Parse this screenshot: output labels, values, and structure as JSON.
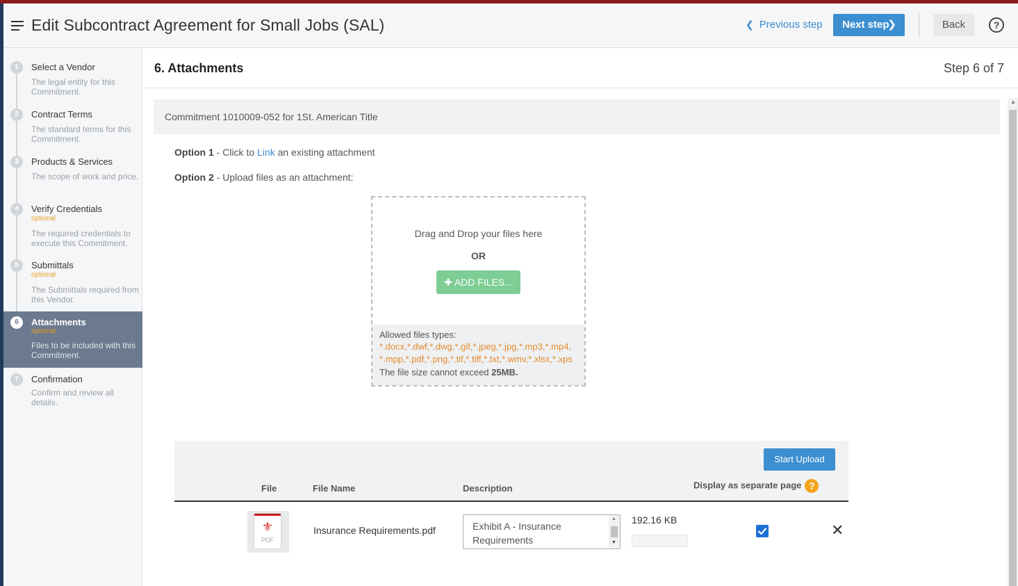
{
  "header": {
    "title": "Edit Subcontract Agreement for Small Jobs (SAL)",
    "previous_step": "Previous step",
    "next_step": "Next step",
    "back": "Back",
    "help_glyph": "?"
  },
  "sidebar": {
    "steps": [
      {
        "number": "1",
        "title": "Select a Vendor",
        "optional": "",
        "description": "The legal entity for this Commitment."
      },
      {
        "number": "2",
        "title": "Contract Terms",
        "optional": "",
        "description": "The standard terms for this Commitment."
      },
      {
        "number": "3",
        "title": "Products & Services",
        "optional": "",
        "description": "The scope of work and price."
      },
      {
        "number": "4",
        "title": "Verify Credentials",
        "optional": "optional",
        "description": "The required credentials to execute this Commitment."
      },
      {
        "number": "5",
        "title": "Submittals",
        "optional": "optional",
        "description": "The Submittals required from this Vendor."
      },
      {
        "number": "6",
        "title": "Attachments",
        "optional": "optional",
        "description": "Files to be included with this Commitment."
      },
      {
        "number": "7",
        "title": "Confirmation",
        "optional": "",
        "description": "Confirm and review all details."
      }
    ],
    "active_step": 6
  },
  "main": {
    "section_title": "6. Attachments",
    "step_count": "Step 6 of 7",
    "commitment": "Commitment 1010009-052 for 1St. American Title",
    "option1": {
      "label": "Option 1",
      "prefix": " - Click to ",
      "link": "Link",
      "suffix": " an existing attachment"
    },
    "option2": {
      "label": "Option 2",
      "text": " - Upload files as an attachment:"
    },
    "dropzone": {
      "drag_text": "Drag and Drop your files here",
      "or_text": "OR",
      "add_files": "ADD FILES...",
      "allowed_label": "Allowed files types:",
      "types_line1": "*.docx,*.dwf,*.dwg,*.gif,*.jpeg,*.jpg,*.mp3,*.mp4,",
      "types_line2": "*.mpp,*.pdf,*.png,*.tif,*.tiff,*.txt,*.wmv,*.xlsx,*.xps",
      "size_prefix": "The file size cannot exceed ",
      "size_limit": "25MB."
    },
    "upload": {
      "start_upload": "Start Upload",
      "columns": {
        "file": "File",
        "file_name": "File Name",
        "description": "Description",
        "display_separate": "Display as separate page"
      },
      "help_glyph": "?",
      "rows": [
        {
          "thumb_label": "PDF",
          "file_name": "Insurance Requirements.pdf",
          "description": "Exhibit A - Insurance Requirements",
          "size": "192.16 KB",
          "progress": 0,
          "display_separate": true
        }
      ]
    }
  },
  "colors": {
    "accent": "#3c8fd0",
    "add_files": "#7dcd94",
    "optional": "#e8a020",
    "file_types": "#e68a2e",
    "active_step_bg": "#6c7a8f"
  },
  "icons": {
    "menu": "hamburger-icon",
    "help": "question-circle-icon",
    "prev": "chevron-left-icon",
    "next": "chevron-right-icon",
    "add": "plus-icon",
    "remove": "close-icon",
    "file": "pdf-file-icon",
    "checkbox": "checkmark-icon"
  }
}
